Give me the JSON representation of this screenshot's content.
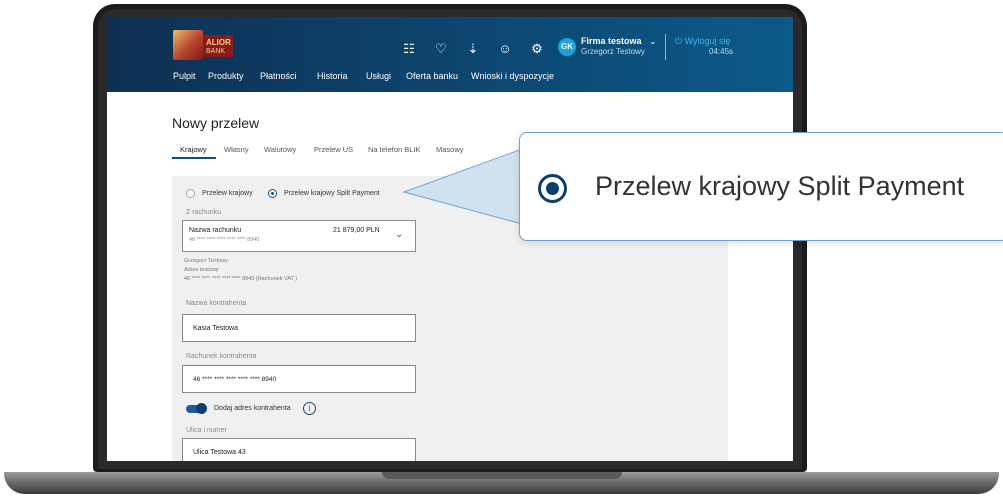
{
  "header": {
    "logo_text": "ALIOR",
    "logo_sub": "BANK",
    "company": "Firma testowa",
    "user": "Grzegorz Testowy",
    "avatar": "GK",
    "logout": "Wyloguj się",
    "timer": "04:45s",
    "icons": [
      "calculator-icon",
      "bell-icon",
      "download-icon",
      "user-icon",
      "settings-icon"
    ]
  },
  "nav": {
    "items": [
      "Pulpit",
      "Produkty",
      "Płatności",
      "Historia",
      "Usługi",
      "Oferta banku",
      "Wnioski i dyspozycje"
    ]
  },
  "page": {
    "title": "Nowy przelew",
    "tabs": [
      "Krajowy",
      "Własny",
      "Walutowy",
      "Przelew US",
      "Na telefon BLIK",
      "Masowy"
    ],
    "active_tab": "Krajowy"
  },
  "form": {
    "radio_domestic": "Przelew krajowy",
    "radio_split": "Przelew krajowy Split Payment",
    "selected_radio": "Przelew krajowy Split Payment",
    "from_label": "Z rachunku",
    "account_name": "Nazwa rachunku",
    "account_number": "46 **** **** **** **** **** 8940",
    "account_balance": "21 879,00 PLN",
    "owner_name": "Grzegorz Testowy",
    "owner_address": "Adres testowy",
    "owner_vat": "46 **** **** **** **** **** 8940 (Rachunek VAT )",
    "payee_name_label": "Nazwa kontrahenta",
    "payee_name_value": "Kasia Testowa",
    "payee_account_label": "Rachunek kontrahenta",
    "payee_account_value": "46 **** **** **** **** **** 8940",
    "add_address_label": "Dodaj adres kontrahenta",
    "add_address_on": true,
    "street_label": "Ulica i numer",
    "street_value": "Ulica Testowa 43"
  },
  "callout": {
    "text": "Przelew krajowy Split Payment"
  },
  "colors": {
    "header_dark": "#0e2f52",
    "header_light": "#0c5a8a",
    "accent": "#0c4f80",
    "link": "#3ab6f0",
    "callout_border": "#6aa2cf"
  }
}
